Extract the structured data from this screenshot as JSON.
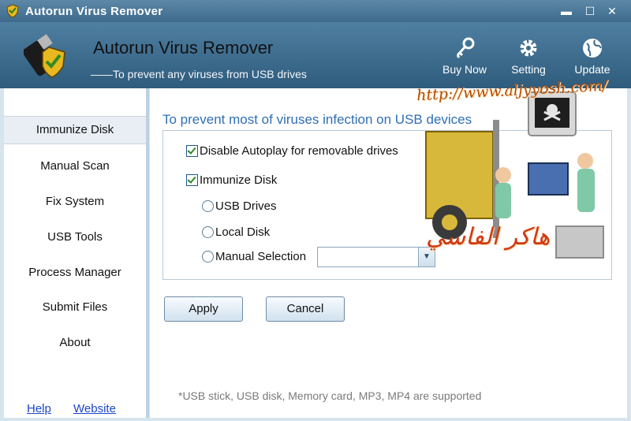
{
  "window": {
    "title": "Autorun Virus Remover",
    "controls": {
      "minimize": "▬",
      "maximize": "☐",
      "close": "✕"
    }
  },
  "header": {
    "app_name": "Autorun Virus Remover",
    "tagline": "——To prevent any viruses from USB drives",
    "tools": [
      {
        "label": "Buy Now",
        "icon": "key-icon"
      },
      {
        "label": "Setting",
        "icon": "gear-icon"
      },
      {
        "label": "Update",
        "icon": "globe-icon"
      }
    ]
  },
  "sidebar": {
    "items": [
      {
        "label": "Immunize Disk",
        "active": true
      },
      {
        "label": "Manual Scan"
      },
      {
        "label": "Fix System"
      },
      {
        "label": "USB Tools"
      },
      {
        "label": "Process Manager"
      },
      {
        "label": "Submit Files"
      },
      {
        "label": "About"
      }
    ],
    "links": {
      "help": "Help",
      "website": "Website"
    }
  },
  "main": {
    "heading": "To prevent most of viruses infection on USB devices",
    "disable_autoplay": {
      "label": "Disable Autoplay for removable drives",
      "checked": true
    },
    "immunize_disk": {
      "label": "Immunize Disk",
      "checked": true
    },
    "options": [
      {
        "label": "USB Drives",
        "selected": false
      },
      {
        "label": "Local Disk",
        "selected": false
      },
      {
        "label": "Manual Selection",
        "selected": false
      }
    ],
    "manual_selection_value": "",
    "apply_label": "Apply",
    "cancel_label": "Cancel",
    "note": "*USB stick, USB disk, Memory card, MP3, MP4 are supported"
  },
  "overlay": {
    "url": "http://www.aljyyosh.com/",
    "arabic_text": "هاكر الفاسي"
  },
  "colors": {
    "accent": "#2f6fb5",
    "header_bg": "#3d6a8b",
    "link": "#1a46c8",
    "watermark_red": "#d03a12"
  }
}
